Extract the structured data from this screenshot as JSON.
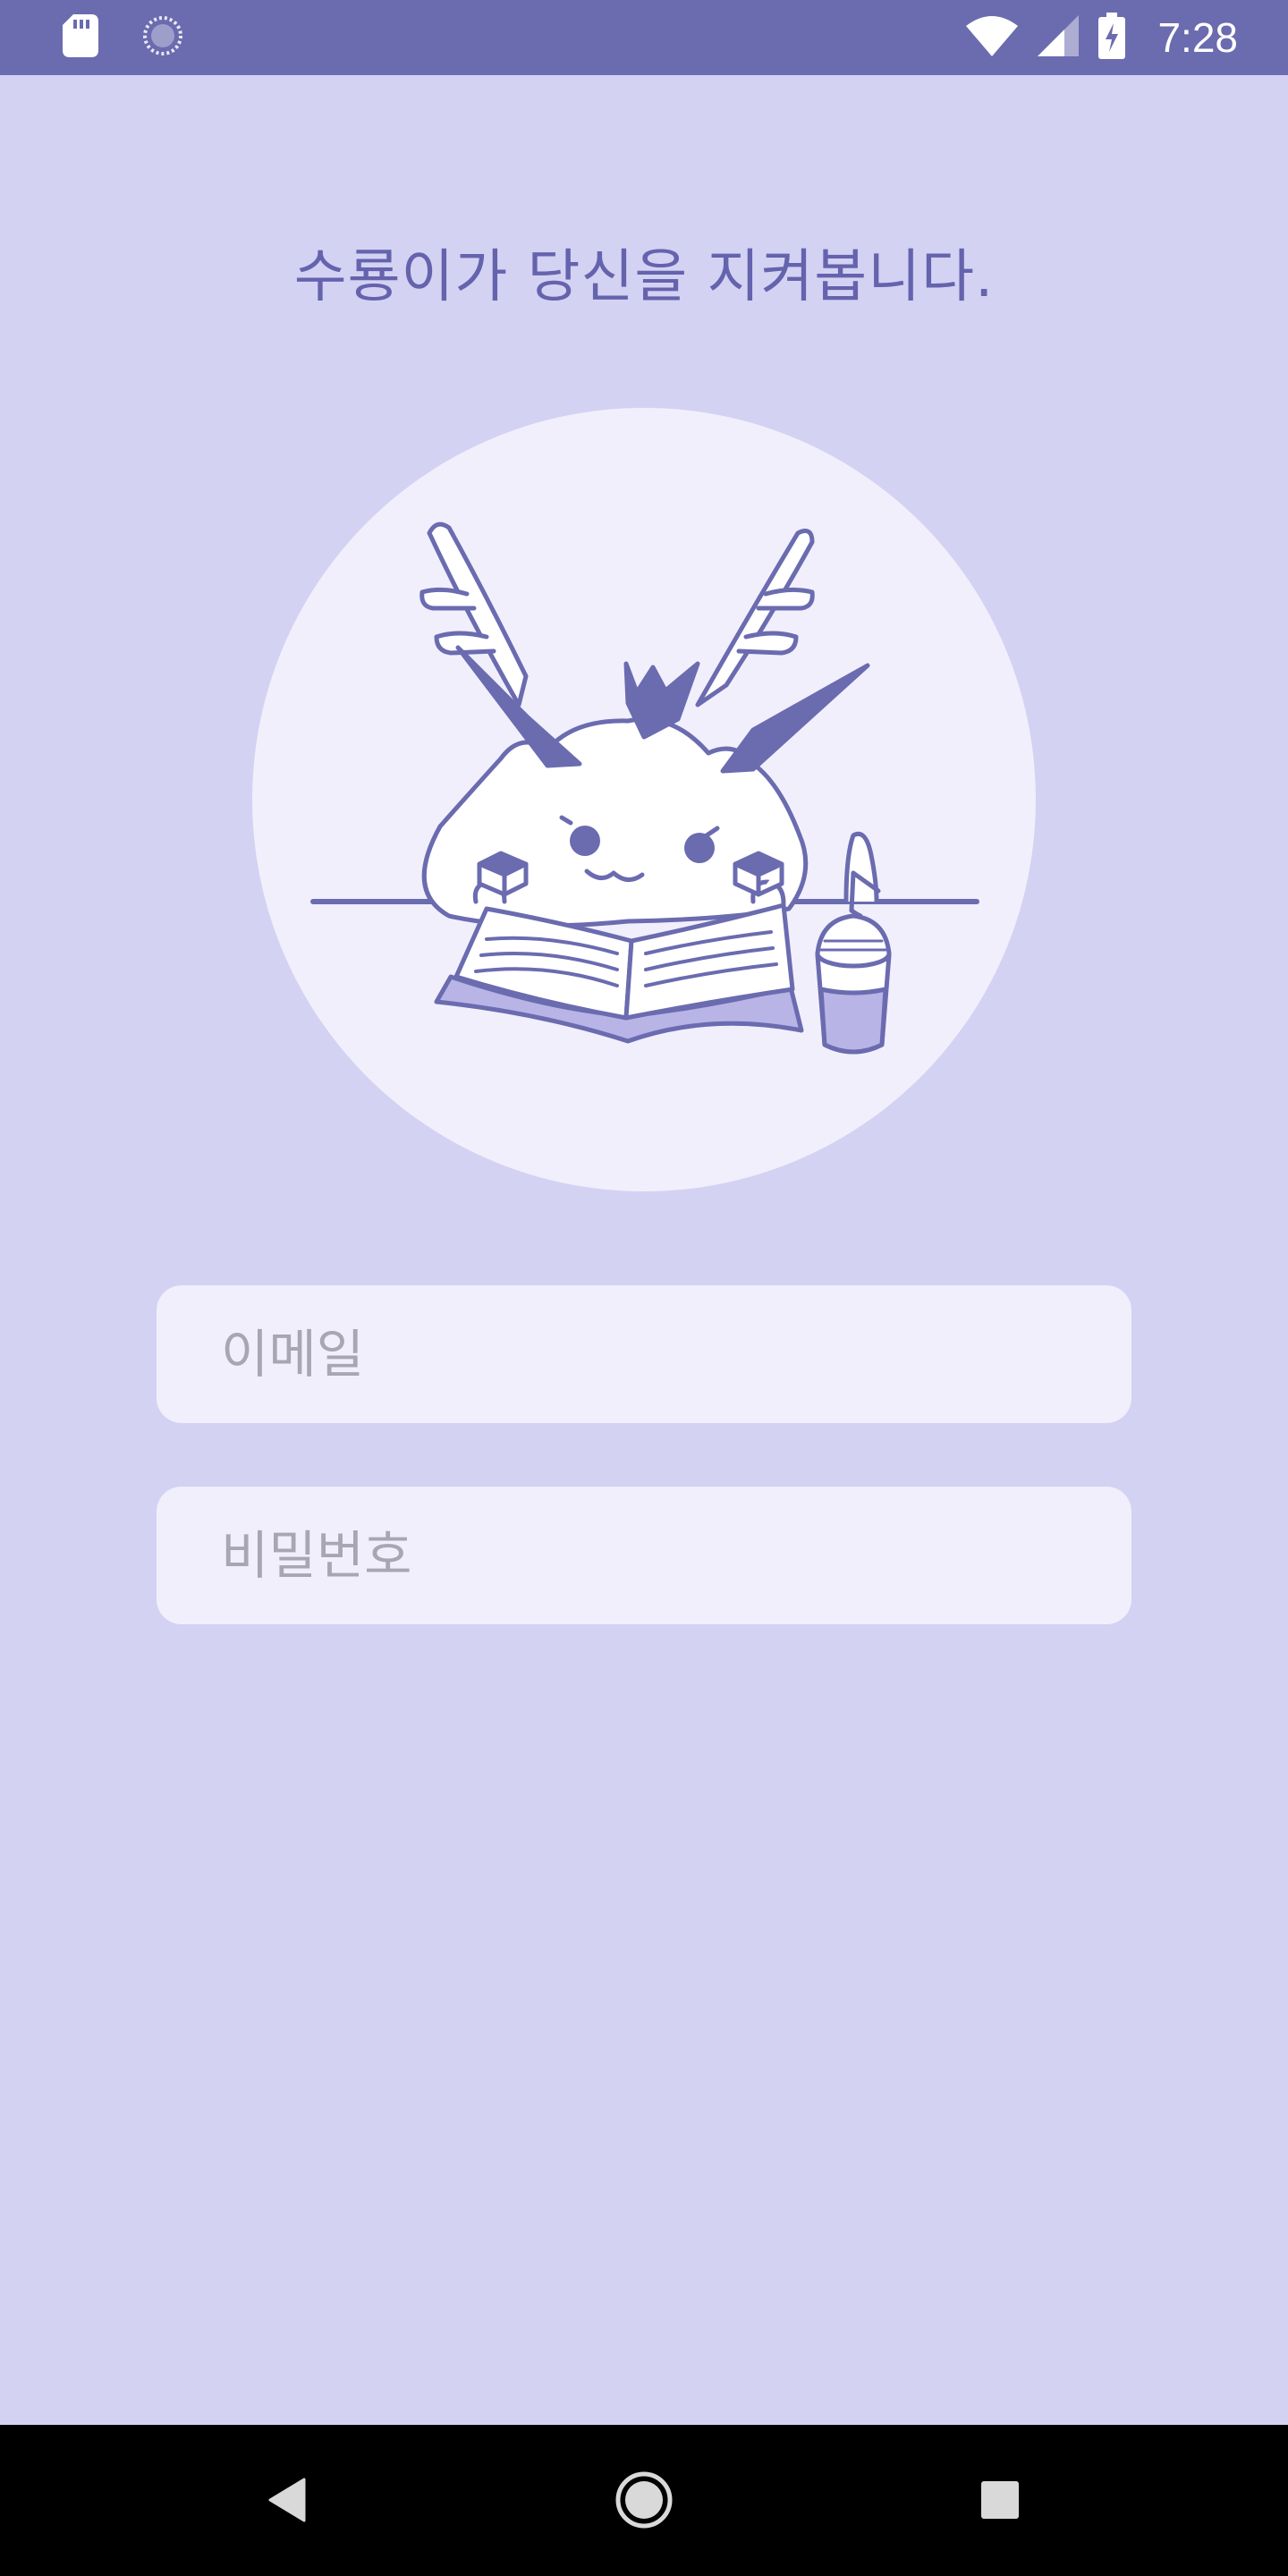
{
  "status_bar": {
    "time": "7:28",
    "icons": [
      "sd-card-icon",
      "sync-icon",
      "wifi-icon",
      "signal-icon",
      "battery-charging-icon"
    ],
    "background": "#6B6BB0"
  },
  "login": {
    "headline": "수룡이가 당신을 지켜봅니다.",
    "email_placeholder": "이메일",
    "password_placeholder": "비밀번호"
  },
  "nav_bar": {
    "icons": [
      "back-icon",
      "home-icon",
      "recents-icon"
    ]
  },
  "colors": {
    "background": "#D3D2F3",
    "accent": "#6B6BB0",
    "field": "#F1EFFC",
    "placeholder": "#A8A6B3"
  }
}
